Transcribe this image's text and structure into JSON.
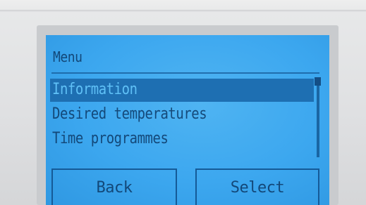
{
  "menu": {
    "title": "Menu",
    "items": [
      {
        "label": "Information",
        "selected": true
      },
      {
        "label": "Desired temperatures",
        "selected": false
      },
      {
        "label": "Time programmes",
        "selected": false
      }
    ]
  },
  "softkeys": {
    "left_label": "Back",
    "right_label": "Select"
  },
  "colors": {
    "lcd_background": "#3ca7ef",
    "lcd_text": "#0e3c6a",
    "selection_highlight": "#1e6fb2"
  }
}
